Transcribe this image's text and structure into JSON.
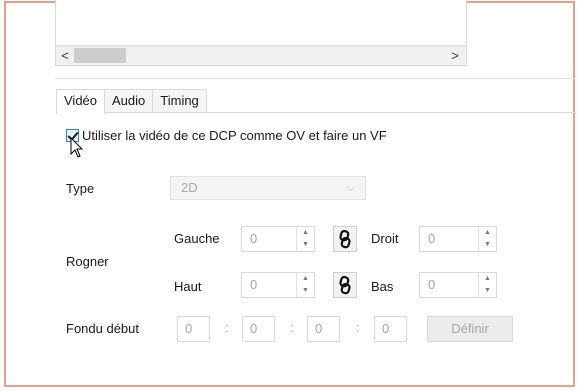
{
  "listbox": {
    "scroll_left": "<",
    "scroll_right": ">"
  },
  "tabs": [
    {
      "label": "Vidéo",
      "active": true
    },
    {
      "label": "Audio",
      "active": false
    },
    {
      "label": "Timing",
      "active": false
    }
  ],
  "video": {
    "ov_checkbox_label": "Utiliser la vidéo de ce DCP comme OV et faire un VF",
    "ov_checked": true,
    "type_label": "Type",
    "type_value": "2D",
    "crop_label": "Rogner",
    "crop": {
      "left_label": "Gauche",
      "left_value": "0",
      "right_label": "Droit",
      "right_value": "0",
      "top_label": "Haut",
      "top_value": "0",
      "bottom_label": "Bas",
      "bottom_value": "0"
    },
    "fade_in_label": "Fondu début",
    "fade_in": [
      "0",
      "0",
      "0",
      "0"
    ],
    "separator": ":",
    "set_button": "Définir"
  },
  "colors": {
    "frame_border": "#e8a08a",
    "checkbox_accent": "#3c7fd0",
    "disabled_text": "#a6a6a6"
  },
  "icons": [
    "scroll-left-icon",
    "scroll-right-icon",
    "chevron-down-icon",
    "link-icon",
    "spin-up-icon",
    "spin-down-icon",
    "mouse-cursor-icon"
  ]
}
